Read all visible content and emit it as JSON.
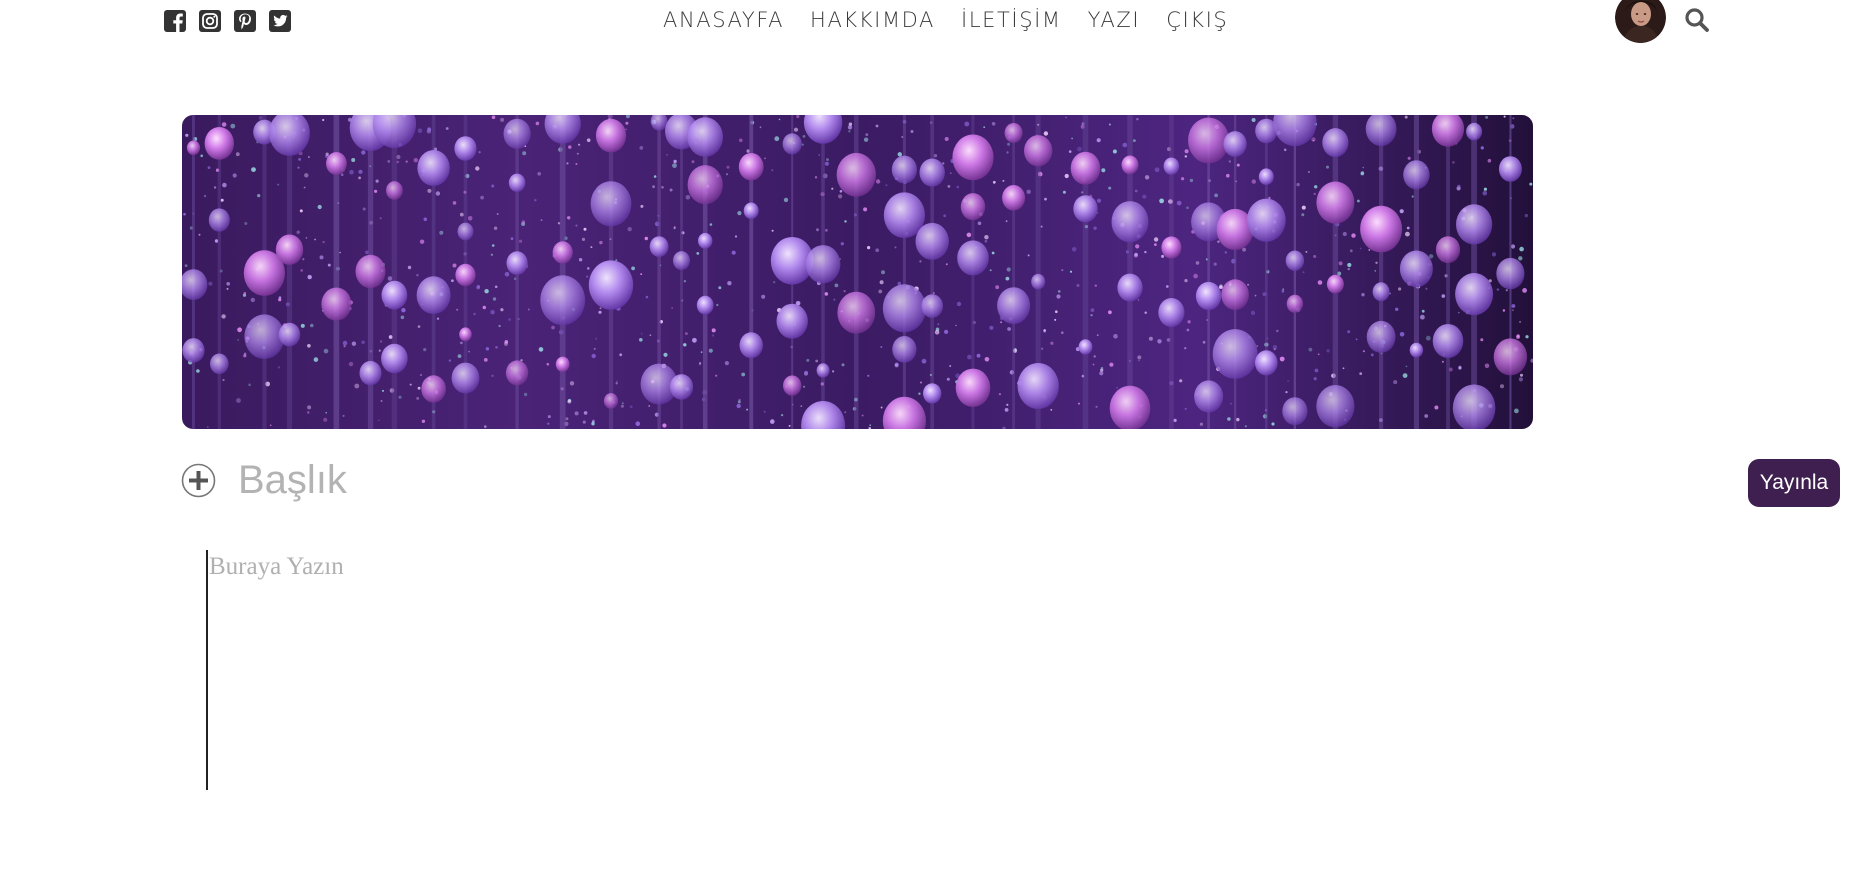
{
  "social": {
    "items": [
      {
        "icon": "facebook-icon"
      },
      {
        "icon": "instagram-icon"
      },
      {
        "icon": "pinterest-icon"
      },
      {
        "icon": "twitter-icon"
      }
    ]
  },
  "nav": {
    "items": [
      {
        "label": "ANASAYFA"
      },
      {
        "label": "HAKKIMDA"
      },
      {
        "label": "İLETİŞİM"
      },
      {
        "label": "YAZI"
      },
      {
        "label": "ÇIKIŞ"
      }
    ]
  },
  "header": {
    "avatar_icon": "user-avatar",
    "search_icon": "search-icon"
  },
  "editor": {
    "add_icon": "plus-circle-icon",
    "title_placeholder": "Başlık",
    "title_value": "",
    "body_placeholder": "Buraya Yazın",
    "body_value": "",
    "publish_label": "Yayınla"
  },
  "colors": {
    "publish_button": "#3f1f4f",
    "icon_dark": "#333333",
    "placeholder": "#b3b3b3",
    "cover_base": "#2a0f4a",
    "cover_accent": "#c77dff"
  }
}
